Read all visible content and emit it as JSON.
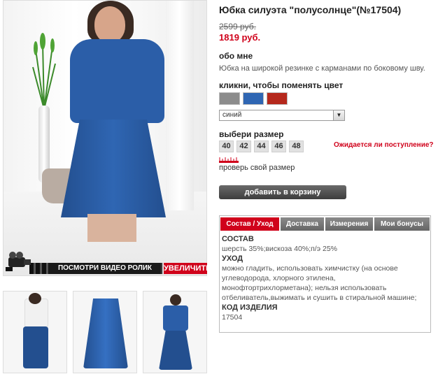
{
  "product": {
    "title": "Юбка силуэта \"полусолнце\"(№17504)",
    "old_price": "2599 руб.",
    "new_price": "1819 руб."
  },
  "about": {
    "label": "обо мне",
    "text": "Юбка на широкой резинке с карманами по боковому шву."
  },
  "color": {
    "label": "кликни, чтобы поменять цвет",
    "swatches": [
      {
        "name": "серый",
        "hex": "#8c8c8c"
      },
      {
        "name": "синий",
        "hex": "#2f66b3"
      },
      {
        "name": "красный",
        "hex": "#b5281c"
      }
    ],
    "selected": "синий"
  },
  "size": {
    "label": "выбери размер",
    "options": [
      "40",
      "42",
      "44",
      "46",
      "48"
    ],
    "expect_link": "Ожидается ли поступление?",
    "check_link": "проверь свой размер"
  },
  "cart_button": "добавить в корзину",
  "media": {
    "video_label": "ПОСМОТРИ ВИДЕО РОЛИК",
    "zoom_label": "УВЕЛИЧИТЬ"
  },
  "tabs": [
    "Состав / Уход",
    "Доставка",
    "Измерения",
    "Мои бонусы"
  ],
  "details": {
    "composition_title": "СОСТАВ",
    "composition": "шерсть 35%;вискоза 40%;п/э 25%",
    "care_title": "УХОД",
    "care": "можно гладить, использовать химчистку (на основе углеводорода, хлорного этилена, монофтортрихлорметана); нельзя использовать отбеливатель,выжимать и сушить в стиральной машине;",
    "code_title": "КОД ИЗДЕЛИЯ",
    "code": "17504"
  },
  "colors": {
    "accent": "#d0021b",
    "button_dark": "#4a4a4a",
    "tab_inactive": "#777777"
  }
}
